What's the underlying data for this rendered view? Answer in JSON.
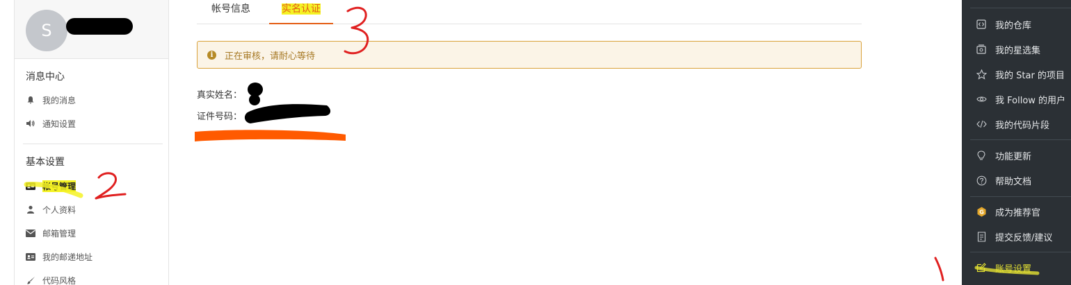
{
  "sidebar": {
    "avatar_letter": "S",
    "sections": [
      {
        "title": "消息中心",
        "items": [
          {
            "label": "我的消息",
            "icon": "bell-icon"
          },
          {
            "label": "通知设置",
            "icon": "volume-icon"
          }
        ]
      },
      {
        "title": "基本设置",
        "items": [
          {
            "label": "帐号管理",
            "icon": "id-card-icon",
            "active": true
          },
          {
            "label": "个人资料",
            "icon": "user-icon"
          },
          {
            "label": "邮箱管理",
            "icon": "envelope-icon"
          },
          {
            "label": "我的邮递地址",
            "icon": "address-card-icon"
          },
          {
            "label": "代码风格",
            "icon": "paintbrush-icon"
          }
        ]
      }
    ]
  },
  "main": {
    "tabs": [
      {
        "label": "帐号信息"
      },
      {
        "label": "实名认证",
        "active": true
      }
    ],
    "alert": "正在审核，请耐心等待",
    "fields": [
      {
        "label": "真实姓名："
      },
      {
        "label": "证件号码："
      }
    ]
  },
  "right_menu": {
    "items": [
      {
        "label": "我的仓库",
        "icon": "code-box-icon"
      },
      {
        "label": "我的星选集",
        "icon": "star-collection-icon"
      },
      {
        "label": "我的 Star 的项目",
        "icon": "star-icon"
      },
      {
        "label": "我 Follow 的用户",
        "icon": "eye-icon"
      },
      {
        "label": "我的代码片段",
        "icon": "code-icon"
      },
      {
        "label": "功能更新",
        "icon": "lightbulb-icon"
      },
      {
        "label": "帮助文档",
        "icon": "question-circle-icon"
      },
      {
        "label": "成为推荐官",
        "icon": "badge-icon"
      },
      {
        "label": "提交反馈/建议",
        "icon": "edit-document-icon"
      },
      {
        "label": "账号设置",
        "icon": "edit-icon"
      }
    ]
  },
  "annotations": [
    "1",
    "2",
    "3"
  ],
  "colors": {
    "accent": "#e45e15",
    "alert_bg": "#fbf4e7",
    "alert_border": "#d9a13a",
    "right_menu_bg": "#2b3035",
    "highlight": "#f4f224",
    "annotation_red": "#e02020",
    "underline_orange": "#ff5a00"
  }
}
